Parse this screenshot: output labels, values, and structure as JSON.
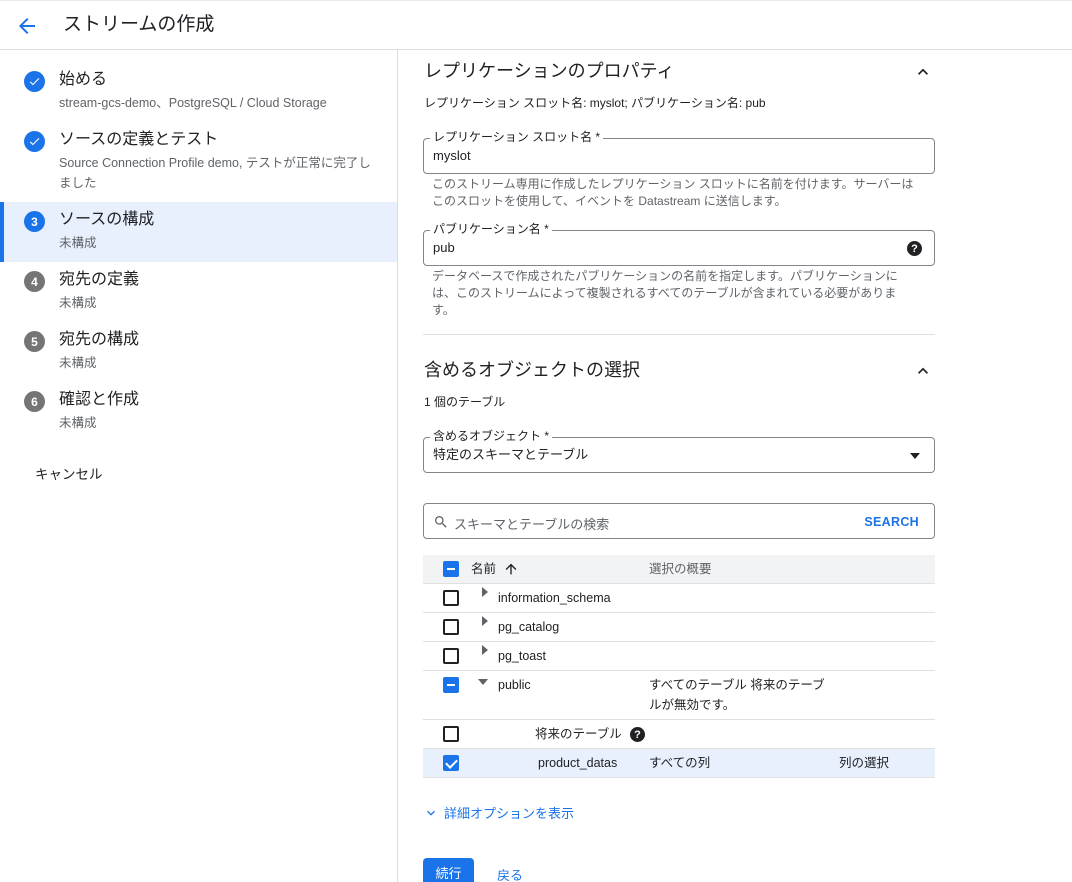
{
  "header": {
    "title": "ストリームの作成",
    "back_icon": "arrow-back-icon"
  },
  "colors": {
    "accent": "#1a73e8",
    "active_bg": "#e8f0fe"
  },
  "steps": [
    {
      "num": "1",
      "title": "始める",
      "sub": "stream-gcs-demo、PostgreSQL / Cloud Storage",
      "state": "done"
    },
    {
      "num": "2",
      "title": "ソースの定義とテスト",
      "sub": "Source Connection Profile demo, テストが正常に完了しました",
      "state": "done"
    },
    {
      "num": "3",
      "title": "ソースの構成",
      "sub": "未構成",
      "state": "current"
    },
    {
      "num": "4",
      "title": "宛先の定義",
      "sub": "未構成",
      "state": "todo"
    },
    {
      "num": "5",
      "title": "宛先の構成",
      "sub": "未構成",
      "state": "todo"
    },
    {
      "num": "6",
      "title": "確認と作成",
      "sub": "未構成",
      "state": "todo"
    }
  ],
  "sidebar": {
    "cancel": "キャンセル"
  },
  "replication": {
    "heading": "レプリケーションのプロパティ",
    "summary": "レプリケーション スロット名: myslot; パブリケーション名: pub",
    "slot_label": "レプリケーション スロット名 *",
    "slot_value": "myslot",
    "slot_help": "このストリーム専用に作成したレプリケーション スロットに名前を付けます。サーバーはこのスロットを使用して、イベントを Datastream に送信します。",
    "pub_label": "パブリケーション名 *",
    "pub_value": "pub",
    "pub_help": "データベースで作成されたパブリケーションの名前を指定します。パブリケーションには、このストリームによって複製されるすべてのテーブルが含まれている必要があります。"
  },
  "objects": {
    "heading": "含めるオブジェクトの選択",
    "count": "1 個のテーブル",
    "include_label": "含めるオブジェクト *",
    "include_value": "特定のスキーマとテーブル",
    "search_placeholder": "スキーマとテーブルの検索",
    "search_button": "SEARCH",
    "col_name": "名前",
    "col_summary": "選択の概要",
    "rows": [
      {
        "name": "information_schema",
        "summary": "",
        "action": ""
      },
      {
        "name": "pg_catalog",
        "summary": "",
        "action": ""
      },
      {
        "name": "pg_toast",
        "summary": "",
        "action": ""
      },
      {
        "name": "public",
        "summary": "すべてのテーブル 将来のテーブルが無効です。",
        "action": ""
      },
      {
        "name": "将来のテーブル",
        "summary": "",
        "action": ""
      },
      {
        "name": "product_datas",
        "summary": "すべての列",
        "action": "列の選択"
      }
    ]
  },
  "footer": {
    "advanced": "詳細オプションを表示",
    "continue": "続行",
    "back": "戻る"
  }
}
